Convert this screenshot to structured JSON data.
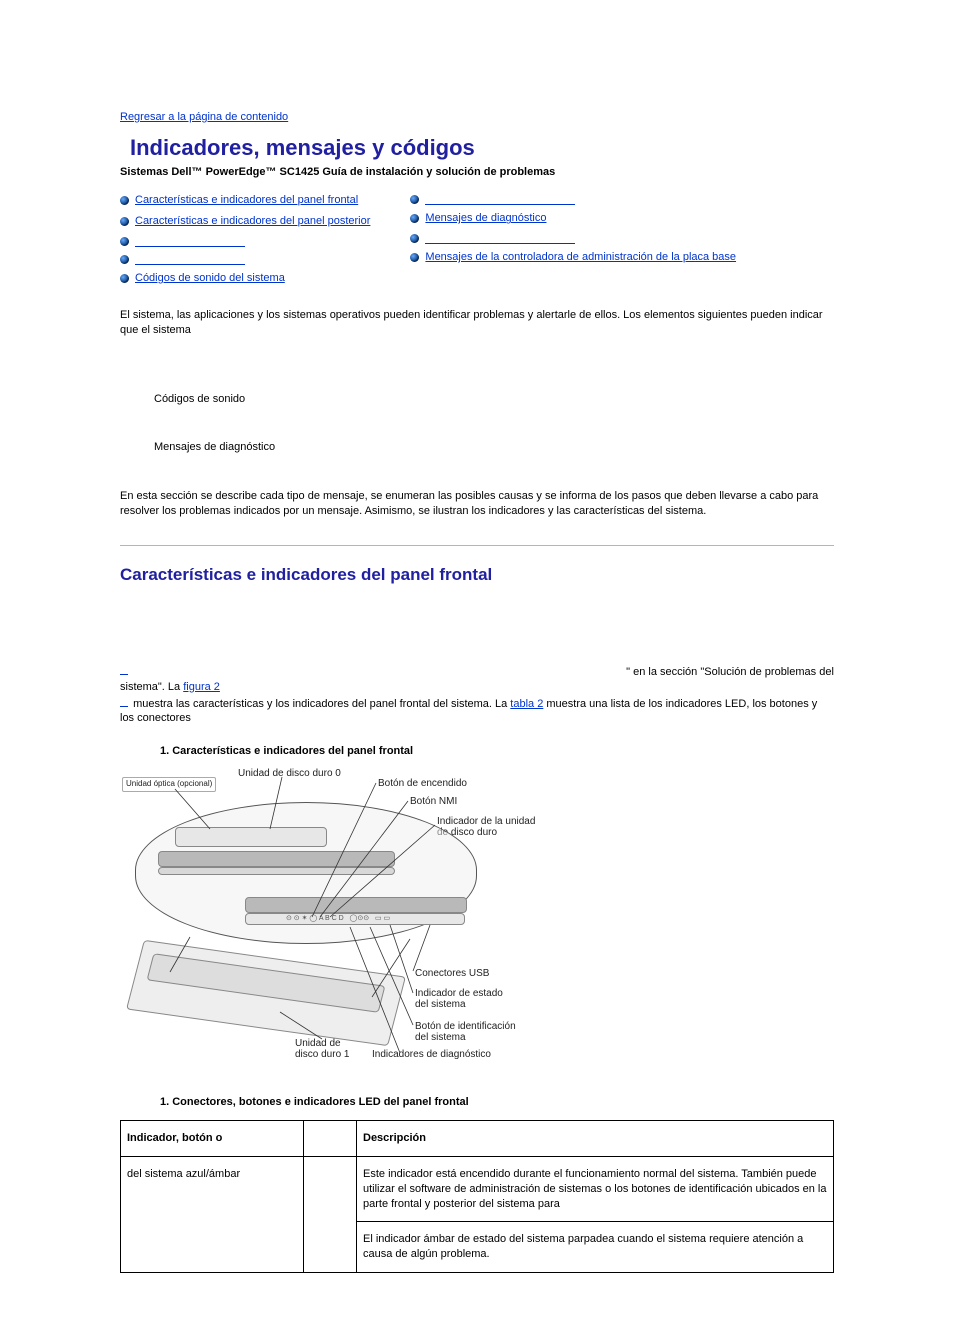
{
  "back_link": "Regresar a la página de contenido",
  "title": "Indicadores, mensajes y códigos",
  "subtitle": "Sistemas Dell™ PowerEdge™ SC1425  Guía de instalación y solución de problemas",
  "toc_left": [
    {
      "label": "Características e indicadores del panel frontal",
      "blank": false
    },
    {
      "label": "Características e indicadores del panel posterior",
      "blank": false
    },
    {
      "label": "",
      "blank": true
    },
    {
      "label": "",
      "blank": true
    },
    {
      "label": "Códigos de sonido del sistema",
      "blank": false
    }
  ],
  "toc_right": [
    {
      "label": "",
      "blank": true,
      "blank_cls": "w150"
    },
    {
      "label": "Mensajes de diagnóstico",
      "blank": false
    },
    {
      "label": "",
      "blank": true,
      "blank_cls": "w150"
    },
    {
      "label": "Mensajes de la controladora de administración de la placa base",
      "blank": false
    }
  ],
  "intro_para": "El sistema, las aplicaciones y los sistemas operativos pueden identificar problemas y alertarle de ellos. Los elementos siguientes pueden indicar que el sistema",
  "bullets_mid": [
    "Códigos de sonido",
    "Mensajes de diagnóstico"
  ],
  "intro_para2": "En esta sección se describe cada tipo de mensaje, se enumeran las posibles causas y se informa de los pasos que deben llevarse a cabo para resolver los problemas indicados por un mensaje. Asimismo, se ilustran los indicadores y las características del sistema.",
  "section1_title": "Características e indicadores del panel frontal",
  "section1_para_pre": "",
  "section1_para_mid1": "\" en la sección \"Solución de problemas del sistema\". La ",
  "section1_link_fig": "figura 2",
  "section1_para_mid2": " muestra las características y los indicadores del panel frontal del sistema. La ",
  "section1_link_tab": "tabla 2",
  "section1_para_mid3": " muestra una lista de los indicadores LED, los botones y los conectores",
  "fig_caption": "1. Características e indicadores del panel frontal",
  "diagram_labels": {
    "opt": "Unidad óptica (opcional)",
    "hd0": "Unidad de disco duro 0",
    "power": "Botón de encendido",
    "nmi": "Botón NMI",
    "hdind": "Indicador de la unidad",
    "hdind2": "de disco duro",
    "usbconn": "Conectores USB",
    "status": "Indicador de estado",
    "status2": "del sistema",
    "idbtn": "Botón de identificación",
    "idbtn2": "del sistema",
    "diag": "Indicadores de diagnóstico",
    "hd1a": "Unidad de",
    "hd1b": "disco duro 1"
  },
  "tbl_caption": "1. Conectores, botones e indicadores LED del panel frontal",
  "table": {
    "headers": [
      "Indicador, botón o",
      "",
      "Descripción"
    ],
    "rows": [
      {
        "a": "del sistema azul/ámbar",
        "b": "",
        "c1": "Este indicador está encendido durante el funcionamiento normal del sistema. También puede utilizar el software de administración de sistemas o los botones de identificación ubicados en la parte frontal y posterior del sistema para",
        "c2": "El indicador ámbar de estado del sistema parpadea cuando el sistema requiere atención a causa de algún problema."
      }
    ]
  }
}
